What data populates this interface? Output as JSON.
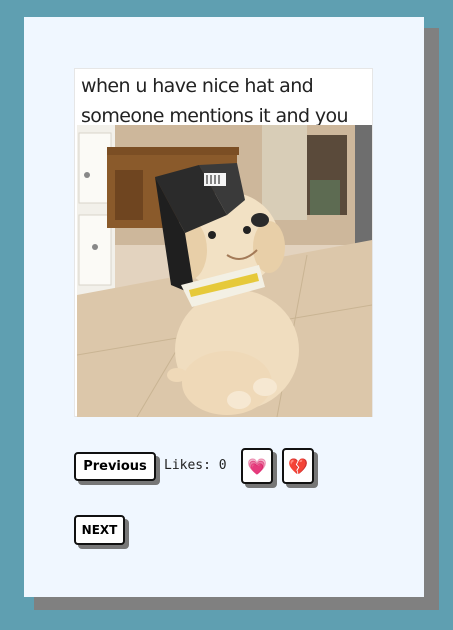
{
  "meme": {
    "caption": "when u have nice hat and someone mentions it and you feel nice"
  },
  "controls": {
    "previous_label": "Previous",
    "likes_label": "Likes:",
    "likes_count": "0",
    "love_emoji": "💗",
    "broken_emoji": "💔",
    "next_label": "NEXT"
  },
  "colors": {
    "page_background": "#5f9fb1",
    "card_background": "#f0f7ff",
    "card_shadow": "#808080"
  }
}
